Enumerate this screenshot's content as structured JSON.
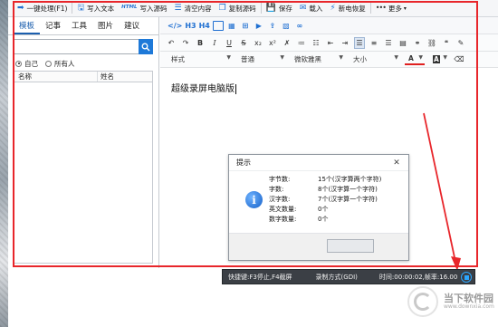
{
  "toolbar": {
    "items": [
      {
        "icon": "arrow-right-icon",
        "label": "一键处理(F1)"
      },
      {
        "icon": "save-text-icon",
        "label": "写入文本"
      },
      {
        "icon": "html-icon",
        "label": "写入源码"
      },
      {
        "icon": "clear-icon",
        "label": "清空内容"
      },
      {
        "icon": "copy-icon",
        "label": "复制源码"
      },
      {
        "icon": "save-icon",
        "label": "保存"
      },
      {
        "icon": "envelope-icon",
        "label": "载入"
      },
      {
        "icon": "lightning-icon",
        "label": "新电恢复"
      },
      {
        "icon": "more-dots-icon",
        "label": "更多"
      }
    ],
    "html_badge": "HTML"
  },
  "left_panel": {
    "tabs": [
      "模板",
      "记事",
      "工具",
      "图片",
      "建议"
    ],
    "active_tab": "模板",
    "radios": [
      {
        "label": "自己",
        "checked": true
      },
      {
        "label": "所有人",
        "checked": false
      }
    ],
    "columns": [
      "名称",
      "姓名"
    ]
  },
  "editor": {
    "heading_buttons": [
      "H3",
      "H4"
    ],
    "style_dropdown": "样式",
    "format_dropdown": "普通",
    "font_dropdown": "微软雅黑",
    "size_dropdown": "大小",
    "text_color_label": "A",
    "bg_color_label": "A",
    "content": "超级录屏电脑版"
  },
  "dialog": {
    "title": "提示",
    "close": "✕",
    "stats": [
      {
        "key": "字节数:",
        "value": "15个(汉字算两个字符)"
      },
      {
        "key": "字数:",
        "value": "8个(汉字算一个字符)"
      },
      {
        "key": "汉字数:",
        "value": "7个(汉字算一个字符)"
      },
      {
        "key": "英文数量:",
        "value": "0个"
      },
      {
        "key": "数字数量:",
        "value": "0个"
      }
    ]
  },
  "recorder": {
    "shortcut": "快捷键:F3停止,F4截屏",
    "mode": "录制方式(GDI)",
    "time": "时间:00:00:02,帧率:16.00"
  },
  "watermark": {
    "name": "当下软件园",
    "sub": "www.downxia.com"
  },
  "colors": {
    "accent": "#1f6fd1",
    "annotation_red": "#e8262b",
    "recorder_bg": "#3b3f45"
  }
}
